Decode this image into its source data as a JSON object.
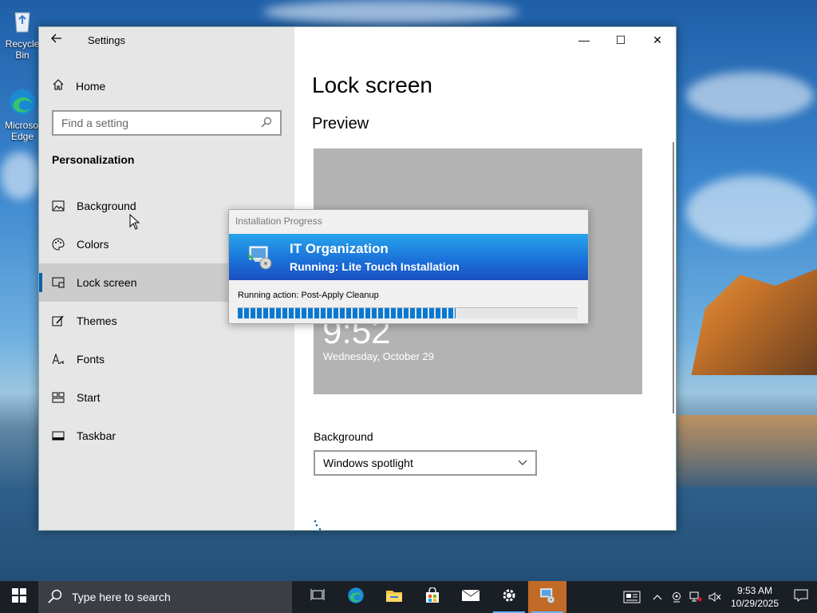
{
  "desktop": {
    "icons": [
      {
        "label": "Recycle Bin",
        "icon": "recycle-bin-icon"
      },
      {
        "label": "Microsoft Edge",
        "icon": "edge-icon"
      }
    ]
  },
  "window": {
    "title": "Settings",
    "controls": {
      "minimize": "—",
      "maximize": "☐",
      "close": "✕"
    }
  },
  "nav": {
    "home_label": "Home",
    "search_placeholder": "Find a setting",
    "section_title": "Personalization",
    "items": [
      {
        "label": "Background",
        "icon": "image-icon",
        "selected": false
      },
      {
        "label": "Colors",
        "icon": "palette-icon",
        "selected": false
      },
      {
        "label": "Lock screen",
        "icon": "lock-screen-icon",
        "selected": true
      },
      {
        "label": "Themes",
        "icon": "themes-icon",
        "selected": false
      },
      {
        "label": "Fonts",
        "icon": "fonts-icon",
        "selected": false
      },
      {
        "label": "Start",
        "icon": "start-icon",
        "selected": false
      },
      {
        "label": "Taskbar",
        "icon": "taskbar-icon",
        "selected": false
      }
    ]
  },
  "content": {
    "page_title": "Lock screen",
    "preview_heading": "Preview",
    "preview_time": "9:52",
    "preview_date": "Wednesday, October 29",
    "background_label": "Background",
    "background_value": "Windows spotlight"
  },
  "dialog": {
    "title": "Installation Progress",
    "organization": "IT Organization",
    "status": "Running: Lite Touch Installation",
    "action": "Running action: Post-Apply Cleanup",
    "progress_fraction": 0.64
  },
  "taskbar": {
    "search_placeholder": "Type here to search",
    "apps": [
      {
        "icon": "task-view-icon",
        "state": "none"
      },
      {
        "icon": "edge-icon",
        "state": "none"
      },
      {
        "icon": "file-explorer-icon",
        "state": "none"
      },
      {
        "icon": "store-icon",
        "state": "none"
      },
      {
        "icon": "mail-icon",
        "state": "none"
      },
      {
        "icon": "settings-gear-icon",
        "state": "open"
      },
      {
        "icon": "deployment-icon",
        "state": "active"
      }
    ],
    "time": "9:53 AM",
    "date": "10/29/2025"
  },
  "colors": {
    "accent": "#0063b1",
    "progress": "#0679d4",
    "banner_top": "#27a4ec",
    "banner_bottom": "#1a4fbf",
    "taskbar": "#1a1f26"
  }
}
